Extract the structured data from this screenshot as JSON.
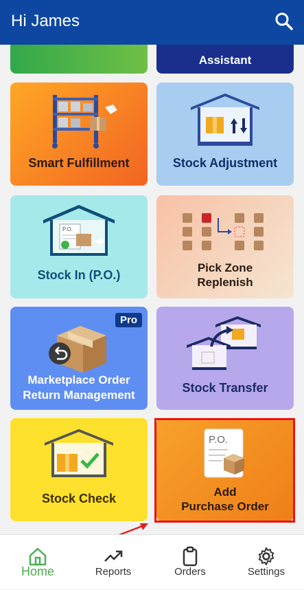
{
  "app_bar": {
    "title": "Hi James",
    "search_icon": "search-icon"
  },
  "tiles": {
    "top_partial_right": "Assistant",
    "smart_fulfillment": "Smart Fulfillment",
    "stock_adjustment": "Stock Adjustment",
    "stock_in": "Stock In (P.O.)",
    "pick_zone_line1": "Pick Zone",
    "pick_zone_line2": "Replenish",
    "marketplace_line1": "Marketplace Order",
    "marketplace_line2": "Return Management",
    "marketplace_badge": "Pro",
    "stock_transfer": "Stock Transfer",
    "stock_check": "Stock Check",
    "add_po_line1": "Add",
    "add_po_line2": "Purchase Order",
    "po_doc_text": "P.O."
  },
  "bottom_nav": [
    {
      "label": "Home",
      "icon": "home-icon",
      "active": true
    },
    {
      "label": "Reports",
      "icon": "trending-up-icon",
      "active": false
    },
    {
      "label": "Orders",
      "icon": "clipboard-icon",
      "active": false
    },
    {
      "label": "Settings",
      "icon": "gear-icon",
      "active": false
    }
  ],
  "colors": {
    "primary": "#0d47a1",
    "active_nav": "#4caf50",
    "highlight": "#ee1111"
  }
}
